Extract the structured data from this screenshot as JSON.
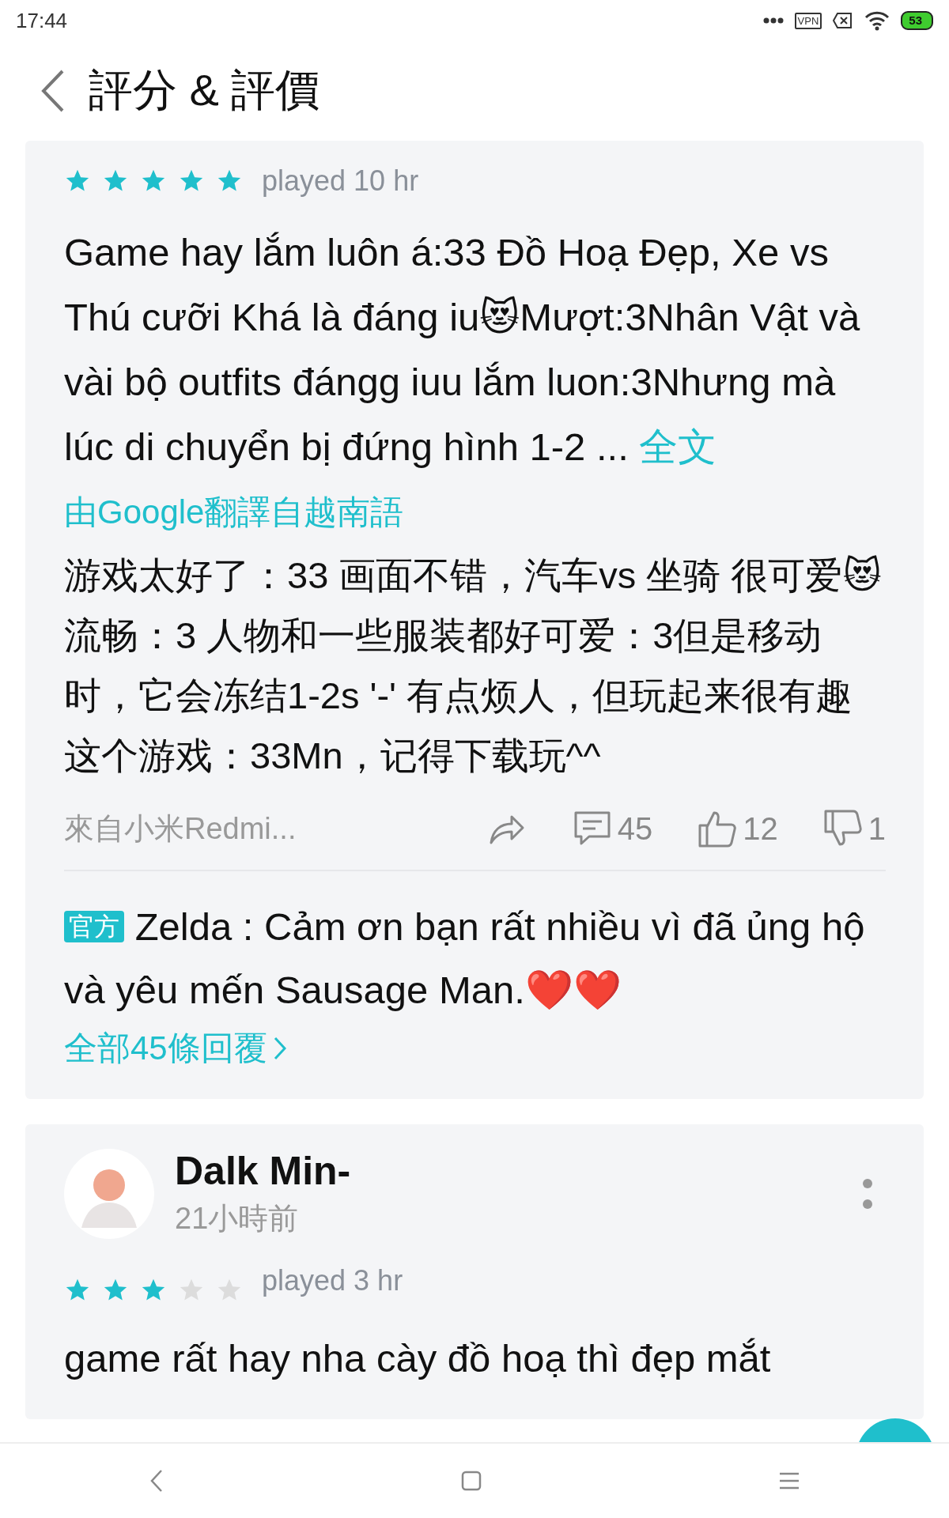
{
  "status_bar": {
    "time": "17:44",
    "vpn": "VPN",
    "battery": "53"
  },
  "header": {
    "title": "評分 & 評價"
  },
  "reviews": [
    {
      "stars": 5,
      "played": "played 10 hr",
      "text": "Game hay lắm luôn á:33 Đồ Hoạ Đẹp, Xe vs Thú cưỡi Khá là đáng iu😻Mượt:3Nhân Vật và vài bộ outfits đángg iuu lắm luon:3Nhưng mà lúc di chuyển bị đứng hình 1-2 ...",
      "more": "全文",
      "translation_note": "由Google翻譯自越南語",
      "translation": "游戏太好了：33 画面不错，汽车vs 坐骑 很可爱😻流畅：3 人物和一些服装都好可爱：3但是移动时，它会冻结1-2s '-' 有点烦人，但玩起来很有趣这个游戏：33Mn，记得下载玩^^",
      "device": "來自小米Redmi...",
      "comments": "45",
      "likes": "12",
      "dislikes": "1",
      "reply": {
        "badge": "官方",
        "text": "Zelda : Cảm ơn bạn rất nhiều vì đã ủng hộ và yêu mến Sausage Man.❤️❤️",
        "all_replies": "全部45條回覆"
      }
    },
    {
      "author": "Dalk Min-",
      "time": "21小時前",
      "stars": 3,
      "played": "played 3 hr",
      "text": "game rất hay nha cày đồ hoạ thì đẹp mắt"
    }
  ]
}
